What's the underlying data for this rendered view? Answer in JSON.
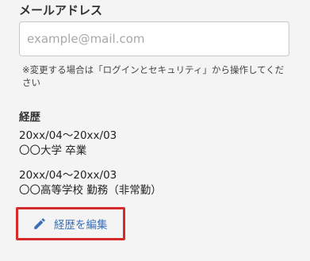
{
  "email": {
    "label": "メールアドレス",
    "placeholder": "example@mail.com",
    "note": "※変更する場合は「ログインとセキュリティ」から操作してください"
  },
  "career": {
    "heading": "経歴",
    "items": [
      {
        "period": "20xx/04〜20xx/03",
        "detail": "〇〇大学 卒業"
      },
      {
        "period": "20xx/04〜20xx/03",
        "detail": "〇〇高等学校 勤務（非常勤）"
      }
    ],
    "edit_button": {
      "label": "経歴を編集",
      "icon": "pencil-icon",
      "highlight_color": "#d62b2b",
      "accent_color": "#3b6fb6"
    }
  }
}
